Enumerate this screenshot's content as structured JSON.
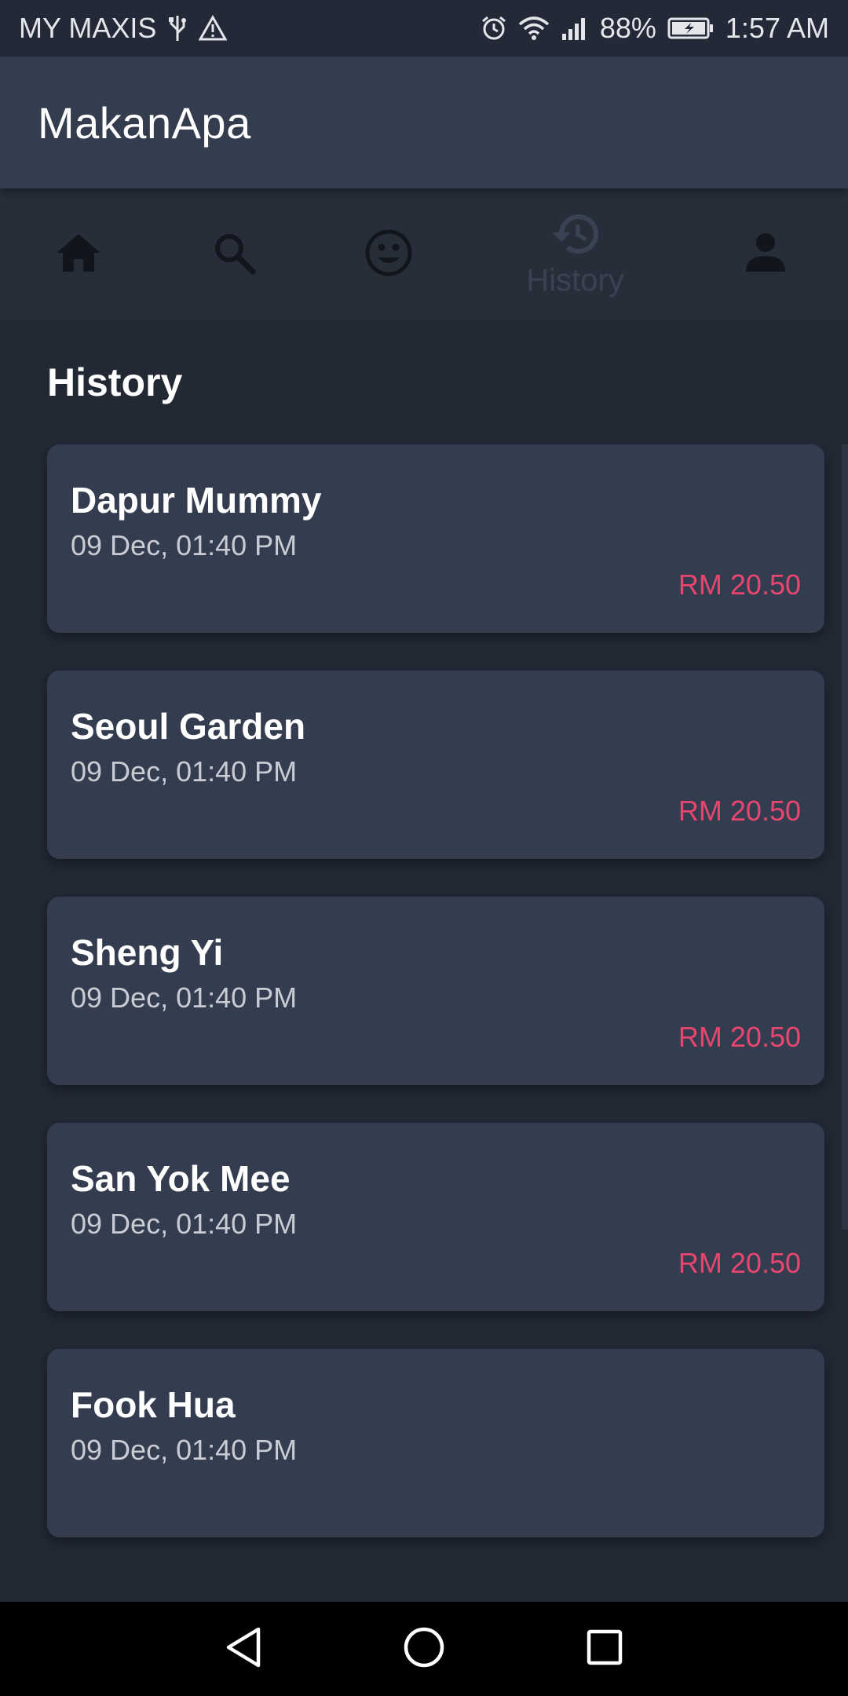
{
  "status_bar": {
    "carrier": "MY MAXIS",
    "battery": "88%",
    "time": "1:57 AM",
    "icons": [
      "usb-icon",
      "warning-icon",
      "alarm-icon",
      "wifi-icon",
      "signal-icon",
      "battery-charging-icon"
    ]
  },
  "app": {
    "title": "MakanApa"
  },
  "tabs": [
    {
      "name": "home",
      "icon": "home-icon",
      "selected": false
    },
    {
      "name": "search",
      "icon": "search-icon",
      "selected": false
    },
    {
      "name": "mood",
      "icon": "smiley-icon",
      "selected": false
    },
    {
      "name": "history",
      "icon": "history-icon",
      "label": "History",
      "selected": true
    },
    {
      "name": "profile",
      "icon": "person-icon",
      "selected": false
    }
  ],
  "section": {
    "title": "History"
  },
  "history": [
    {
      "name": "Dapur Mummy",
      "date": "09 Dec, 01:40 PM",
      "price": "RM 20.50"
    },
    {
      "name": "Seoul Garden",
      "date": "09 Dec, 01:40 PM",
      "price": "RM 20.50"
    },
    {
      "name": "Sheng Yi",
      "date": "09 Dec, 01:40 PM",
      "price": "RM 20.50"
    },
    {
      "name": "San Yok Mee",
      "date": "09 Dec, 01:40 PM",
      "price": "RM 20.50"
    },
    {
      "name": "Fook Hua",
      "date": "09 Dec, 01:40 PM",
      "price": ""
    }
  ],
  "colors": {
    "background": "#222834",
    "app_bar": "#343d4e",
    "card": "#343d4f",
    "price": "#e8456f"
  },
  "nav_bar": {
    "icons": [
      "back-icon",
      "home-circle-icon",
      "recents-icon"
    ]
  }
}
